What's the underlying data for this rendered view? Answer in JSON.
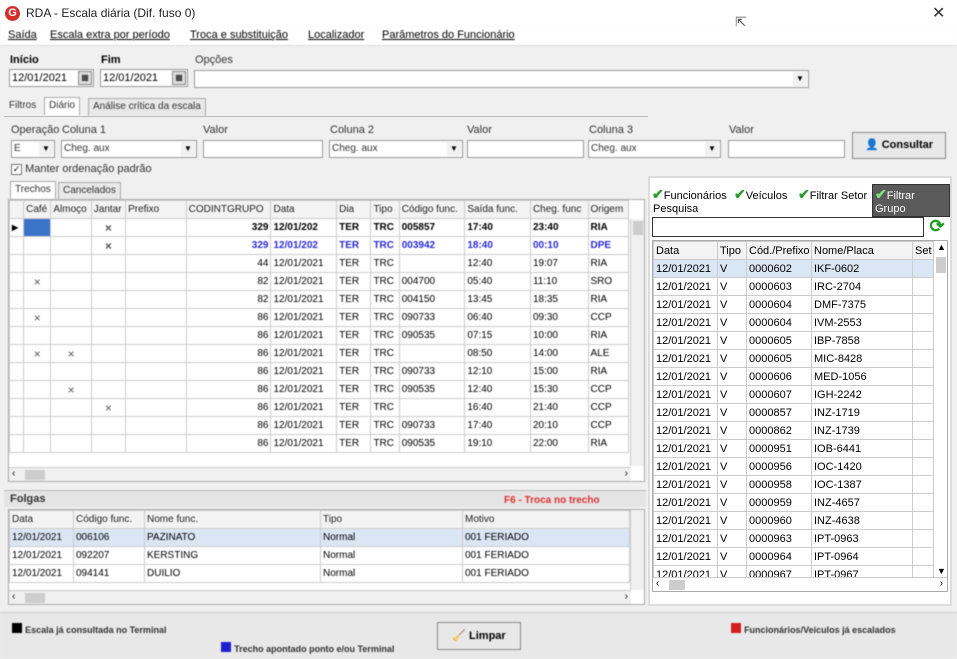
{
  "window": {
    "title": "RDA - Escala diária (Dif. fuso 0)"
  },
  "menu": [
    "Saída",
    "Escala extra por período",
    "Troca e substituição",
    "Localizador",
    "Parâmetros do Funcionário"
  ],
  "header": {
    "inicio_label": "Início",
    "inicio_value": "12/01/2021",
    "fim_label": "Fim",
    "fim_value": "12/01/2021",
    "opcoes_label": "Opções"
  },
  "top_tabs": [
    "Filtros",
    "Diário",
    "Análise crítica da escala"
  ],
  "filters": {
    "operacao_label": "Operação",
    "operacao_value": "E",
    "coluna1_label": "Coluna 1",
    "coluna1_value": "Cheg. aux",
    "valor1_label": "Valor",
    "coluna2_label": "Coluna 2",
    "coluna2_value": "Cheg. aux",
    "valor2_label": "Valor",
    "coluna3_label": "Coluna 3",
    "coluna3_value": "Cheg. aux",
    "valor3_label": "Valor",
    "consultar_label": "Consultar",
    "manter_label": "Manter ordenação padrão"
  },
  "sub_tabs": [
    "Trechos",
    "Cancelados"
  ],
  "trechos": {
    "columns": [
      "Café",
      "Almoço",
      "Jantar",
      "Prefixo",
      "CODINTGRUPO",
      "Data",
      "Dia",
      "Tipo",
      "Código func.",
      "Saída func.",
      "Cheg. func",
      "Origem"
    ],
    "rows": [
      {
        "style": "boldrow",
        "cafe": "",
        "almoco": "",
        "jantar": "×",
        "prefixo": "",
        "cod": "329",
        "data": "12/01/202",
        "dia": "TER",
        "tipo": "TRC",
        "codfunc": "005857",
        "saida": "17:40",
        "cheg": "23:40",
        "origem": "RIA"
      },
      {
        "style": "blue",
        "cafe": "",
        "almoco": "",
        "jantar": "×",
        "prefixo": "",
        "cod": "329",
        "data": "12/01/202",
        "dia": "TER",
        "tipo": "TRC",
        "codfunc": "003942",
        "saida": "18:40",
        "cheg": "00:10",
        "origem": "DPE"
      },
      {
        "style": "",
        "cafe": "",
        "almoco": "",
        "jantar": "",
        "prefixo": "",
        "cod": "44",
        "data": "12/01/2021",
        "dia": "TER",
        "tipo": "TRC",
        "codfunc": "",
        "saida": "12:40",
        "cheg": "19:07",
        "origem": "RIA"
      },
      {
        "style": "",
        "cafe": "×",
        "almoco": "",
        "jantar": "",
        "prefixo": "",
        "cod": "82",
        "data": "12/01/2021",
        "dia": "TER",
        "tipo": "TRC",
        "codfunc": "004700",
        "saida": "05:40",
        "cheg": "11:10",
        "origem": "SRO"
      },
      {
        "style": "",
        "cafe": "",
        "almoco": "",
        "jantar": "",
        "prefixo": "",
        "cod": "82",
        "data": "12/01/2021",
        "dia": "TER",
        "tipo": "TRC",
        "codfunc": "004150",
        "saida": "13:45",
        "cheg": "18:35",
        "origem": "RIA"
      },
      {
        "style": "",
        "cafe": "×",
        "almoco": "",
        "jantar": "",
        "prefixo": "",
        "cod": "86",
        "data": "12/01/2021",
        "dia": "TER",
        "tipo": "TRC",
        "codfunc": "090733",
        "saida": "06:40",
        "cheg": "09:30",
        "origem": "CCP"
      },
      {
        "style": "",
        "cafe": "",
        "almoco": "",
        "jantar": "",
        "prefixo": "",
        "cod": "86",
        "data": "12/01/2021",
        "dia": "TER",
        "tipo": "TRC",
        "codfunc": "090535",
        "saida": "07:15",
        "cheg": "10:00",
        "origem": "RIA"
      },
      {
        "style": "",
        "cafe": "×",
        "almoco": "×",
        "jantar": "",
        "prefixo": "",
        "cod": "86",
        "data": "12/01/2021",
        "dia": "TER",
        "tipo": "TRC",
        "codfunc": "",
        "saida": "08:50",
        "cheg": "14:00",
        "origem": "ALE"
      },
      {
        "style": "",
        "cafe": "",
        "almoco": "",
        "jantar": "",
        "prefixo": "",
        "cod": "86",
        "data": "12/01/2021",
        "dia": "TER",
        "tipo": "TRC",
        "codfunc": "090733",
        "saida": "12:10",
        "cheg": "15:00",
        "origem": "RIA"
      },
      {
        "style": "",
        "cafe": "",
        "almoco": "×",
        "jantar": "",
        "prefixo": "",
        "cod": "86",
        "data": "12/01/2021",
        "dia": "TER",
        "tipo": "TRC",
        "codfunc": "090535",
        "saida": "12:40",
        "cheg": "15:30",
        "origem": "CCP"
      },
      {
        "style": "",
        "cafe": "",
        "almoco": "",
        "jantar": "×",
        "prefixo": "",
        "cod": "86",
        "data": "12/01/2021",
        "dia": "TER",
        "tipo": "TRC",
        "codfunc": "",
        "saida": "16:40",
        "cheg": "21:40",
        "origem": "CCP"
      },
      {
        "style": "",
        "cafe": "",
        "almoco": "",
        "jantar": "",
        "prefixo": "",
        "cod": "86",
        "data": "12/01/2021",
        "dia": "TER",
        "tipo": "TRC",
        "codfunc": "090733",
        "saida": "17:40",
        "cheg": "20:10",
        "origem": "CCP"
      },
      {
        "style": "",
        "cafe": "",
        "almoco": "",
        "jantar": "",
        "prefixo": "",
        "cod": "86",
        "data": "12/01/2021",
        "dia": "TER",
        "tipo": "TRC",
        "codfunc": "090535",
        "saida": "19:10",
        "cheg": "22:00",
        "origem": "RIA"
      }
    ]
  },
  "folgas": {
    "title": "Folgas",
    "hint": "F6 - Troca no trecho",
    "columns": [
      "Data",
      "Código func.",
      "Nome func.",
      "Tipo",
      "Motivo"
    ],
    "rows": [
      {
        "data": "12/01/2021",
        "cod": "006106",
        "nome": "PAZINATO",
        "tipo": "Normal",
        "motivo": "001 FERIADO"
      },
      {
        "data": "12/01/2021",
        "cod": "092207",
        "nome": "KERSTING",
        "tipo": "Normal",
        "motivo": "001 FERIADO"
      },
      {
        "data": "12/01/2021",
        "cod": "094141",
        "nome": "DUILIO",
        "tipo": "Normal",
        "motivo": "001 FERIADO"
      }
    ]
  },
  "right_panel": {
    "filters": [
      "Funcionários",
      "Veículos",
      "Filtrar Setor",
      "Filtrar Grupo"
    ],
    "pesquisa_label": "Pesquisa",
    "columns": [
      "Data",
      "Tipo",
      "Cód./Prefixo",
      "Nome/Placa",
      "Set"
    ],
    "rows": [
      [
        "12/01/2021",
        "V",
        "0000602",
        "IKF-0602"
      ],
      [
        "12/01/2021",
        "V",
        "0000603",
        "IRC-2704"
      ],
      [
        "12/01/2021",
        "V",
        "0000604",
        "DMF-7375"
      ],
      [
        "12/01/2021",
        "V",
        "0000604",
        "IVM-2553"
      ],
      [
        "12/01/2021",
        "V",
        "0000605",
        "IBP-7858"
      ],
      [
        "12/01/2021",
        "V",
        "0000605",
        "MIC-8428"
      ],
      [
        "12/01/2021",
        "V",
        "0000606",
        "MED-1056"
      ],
      [
        "12/01/2021",
        "V",
        "0000607",
        "IGH-2242"
      ],
      [
        "12/01/2021",
        "V",
        "0000857",
        "INZ-1719"
      ],
      [
        "12/01/2021",
        "V",
        "0000862",
        "INZ-1739"
      ],
      [
        "12/01/2021",
        "V",
        "0000951",
        "IOB-6441"
      ],
      [
        "12/01/2021",
        "V",
        "0000956",
        "IOC-1420"
      ],
      [
        "12/01/2021",
        "V",
        "0000958",
        "IOC-1387"
      ],
      [
        "12/01/2021",
        "V",
        "0000959",
        "INZ-4657"
      ],
      [
        "12/01/2021",
        "V",
        "0000960",
        "INZ-4638"
      ],
      [
        "12/01/2021",
        "V",
        "0000963",
        "IPT-0963"
      ],
      [
        "12/01/2021",
        "V",
        "0000964",
        "IPT-0964"
      ],
      [
        "12/01/2021",
        "V",
        "0000967",
        "IPT-0967"
      ]
    ]
  },
  "footer": {
    "legend_black": "Escala já consultada no Terminal",
    "legend_blue": "Trecho apontado ponto e/ou Terminal",
    "legend_red": "Funcionários/Veículos já escalados",
    "limpar_label": "Limpar",
    "color_black": "#000000",
    "color_blue": "#1f1fd0",
    "color_red": "#d01f1f"
  }
}
